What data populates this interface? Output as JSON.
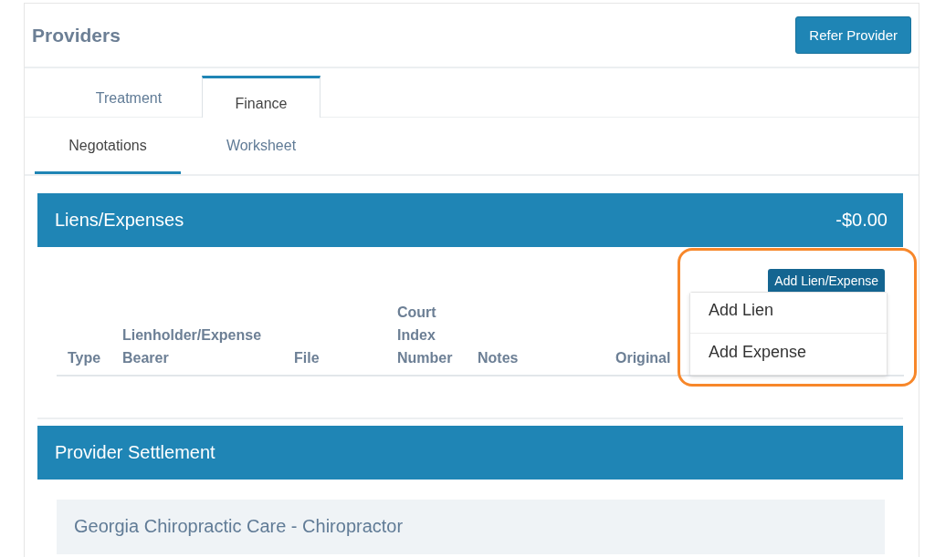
{
  "header": {
    "title": "Providers",
    "action": "Refer Provider"
  },
  "tabs": [
    {
      "label": "Treatment",
      "selected": false
    },
    {
      "label": "Finance",
      "selected": true
    }
  ],
  "subtabs": [
    {
      "label": "Negotations",
      "selected": true
    },
    {
      "label": "Worksheet",
      "selected": false
    }
  ],
  "liens": {
    "title": "Liens/Expenses",
    "total": "-$0.00",
    "add_button": "Add Lien/Expense",
    "menu": [
      {
        "label": "Add Lien"
      },
      {
        "label": "Add Expense"
      }
    ],
    "menu_open": true,
    "highlighted": true,
    "columns": [
      [
        "Type"
      ],
      [
        "Lienholder/Expense",
        "Bearer"
      ],
      [
        "File"
      ],
      [
        "Court",
        "Index",
        "Number"
      ],
      [
        "Notes"
      ],
      [
        "Original"
      ]
    ]
  },
  "settlement": {
    "title": "Provider Settlement",
    "items": [
      "Georgia Chiropractic Care - Chiropractor"
    ]
  }
}
